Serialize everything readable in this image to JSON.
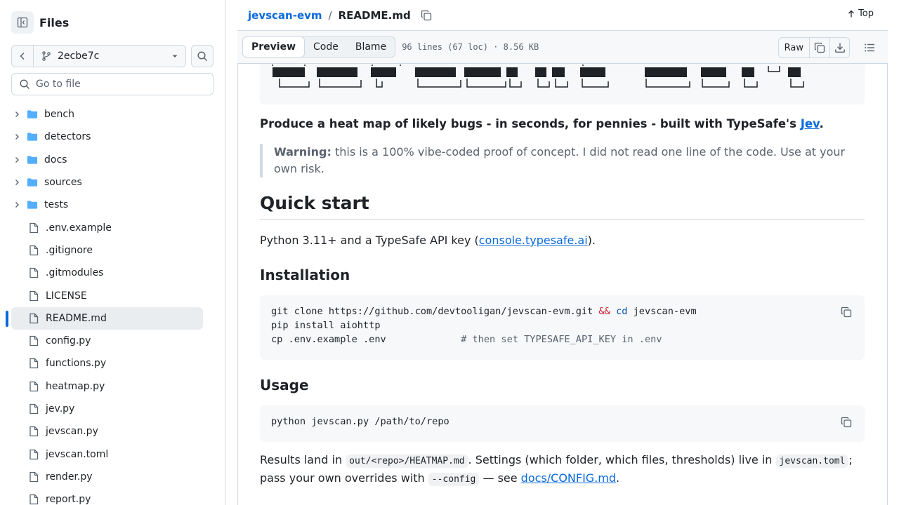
{
  "sidebar": {
    "title": "Files",
    "branch": "2ecbe7c",
    "goto_placeholder": "Go to file",
    "items": [
      {
        "label": "bench",
        "type": "folder"
      },
      {
        "label": "detectors",
        "type": "folder"
      },
      {
        "label": "docs",
        "type": "folder"
      },
      {
        "label": "sources",
        "type": "folder"
      },
      {
        "label": "tests",
        "type": "folder"
      },
      {
        "label": ".env.example",
        "type": "file"
      },
      {
        "label": ".gitignore",
        "type": "file"
      },
      {
        "label": ".gitmodules",
        "type": "file"
      },
      {
        "label": "LICENSE",
        "type": "file"
      },
      {
        "label": "README.md",
        "type": "file",
        "active": true
      },
      {
        "label": "config.py",
        "type": "file"
      },
      {
        "label": "functions.py",
        "type": "file"
      },
      {
        "label": "heatmap.py",
        "type": "file"
      },
      {
        "label": "jev.py",
        "type": "file"
      },
      {
        "label": "jevscan.py",
        "type": "file"
      },
      {
        "label": "jevscan.toml",
        "type": "file"
      },
      {
        "label": "render.py",
        "type": "file"
      },
      {
        "label": "report.py",
        "type": "file"
      }
    ]
  },
  "header": {
    "repo": "jevscan-evm",
    "separator": "/",
    "file": "README.md",
    "top_label": "Top"
  },
  "toolbar": {
    "tabs": [
      "Preview",
      "Code",
      "Blame"
    ],
    "active_tab": "Preview",
    "file_info": "96 lines (67 loc) · 8.56 KB",
    "raw_label": "Raw"
  },
  "readme": {
    "lead_text": "Produce a heat map of likely bugs - in seconds, for pennies - built with TypeSafe's ",
    "lead_link": "Jev",
    "lead_end": ".",
    "warning_label": "Warning:",
    "warning_text": " this is a 100% vibe-coded proof of concept. I did not read one line of the code. Use at your own risk.",
    "quickstart_heading": "Quick start",
    "quickstart_text": "Python 3.11+ and a TypeSafe API key (",
    "quickstart_link": "console.typesafe.ai",
    "quickstart_end": ").",
    "installation_heading": "Installation",
    "install_code": {
      "line1_cmd": "git clone https://github.com/devtooligan/jevscan-evm.git ",
      "line1_op": "&&",
      "line1_cd": "cd",
      "line1_rest": " jevscan-evm",
      "line2": "pip install aiohttp",
      "line3_cmd": "cp .env.example .env",
      "line3_comment": "# then set TYPESAFE_API_KEY in .env"
    },
    "usage_heading": "Usage",
    "usage_code": "python jevscan.py /path/to/repo",
    "results_pre": "Results land in ",
    "results_code1": "out/<repo>/HEATMAP.md",
    "results_mid": ". Settings (which folder, which files, thresholds) live in ",
    "results_code2": "jevscan.toml",
    "results_mid2": "; pass your own overrides with ",
    "results_code3": "--config",
    "results_mid3": " — see ",
    "results_link": "docs/CONFIG.md",
    "results_end": "."
  },
  "colors": {
    "accent": "#0969da",
    "border": "#d1d9e0",
    "folder": "#54aeff",
    "muted": "#59636e"
  }
}
